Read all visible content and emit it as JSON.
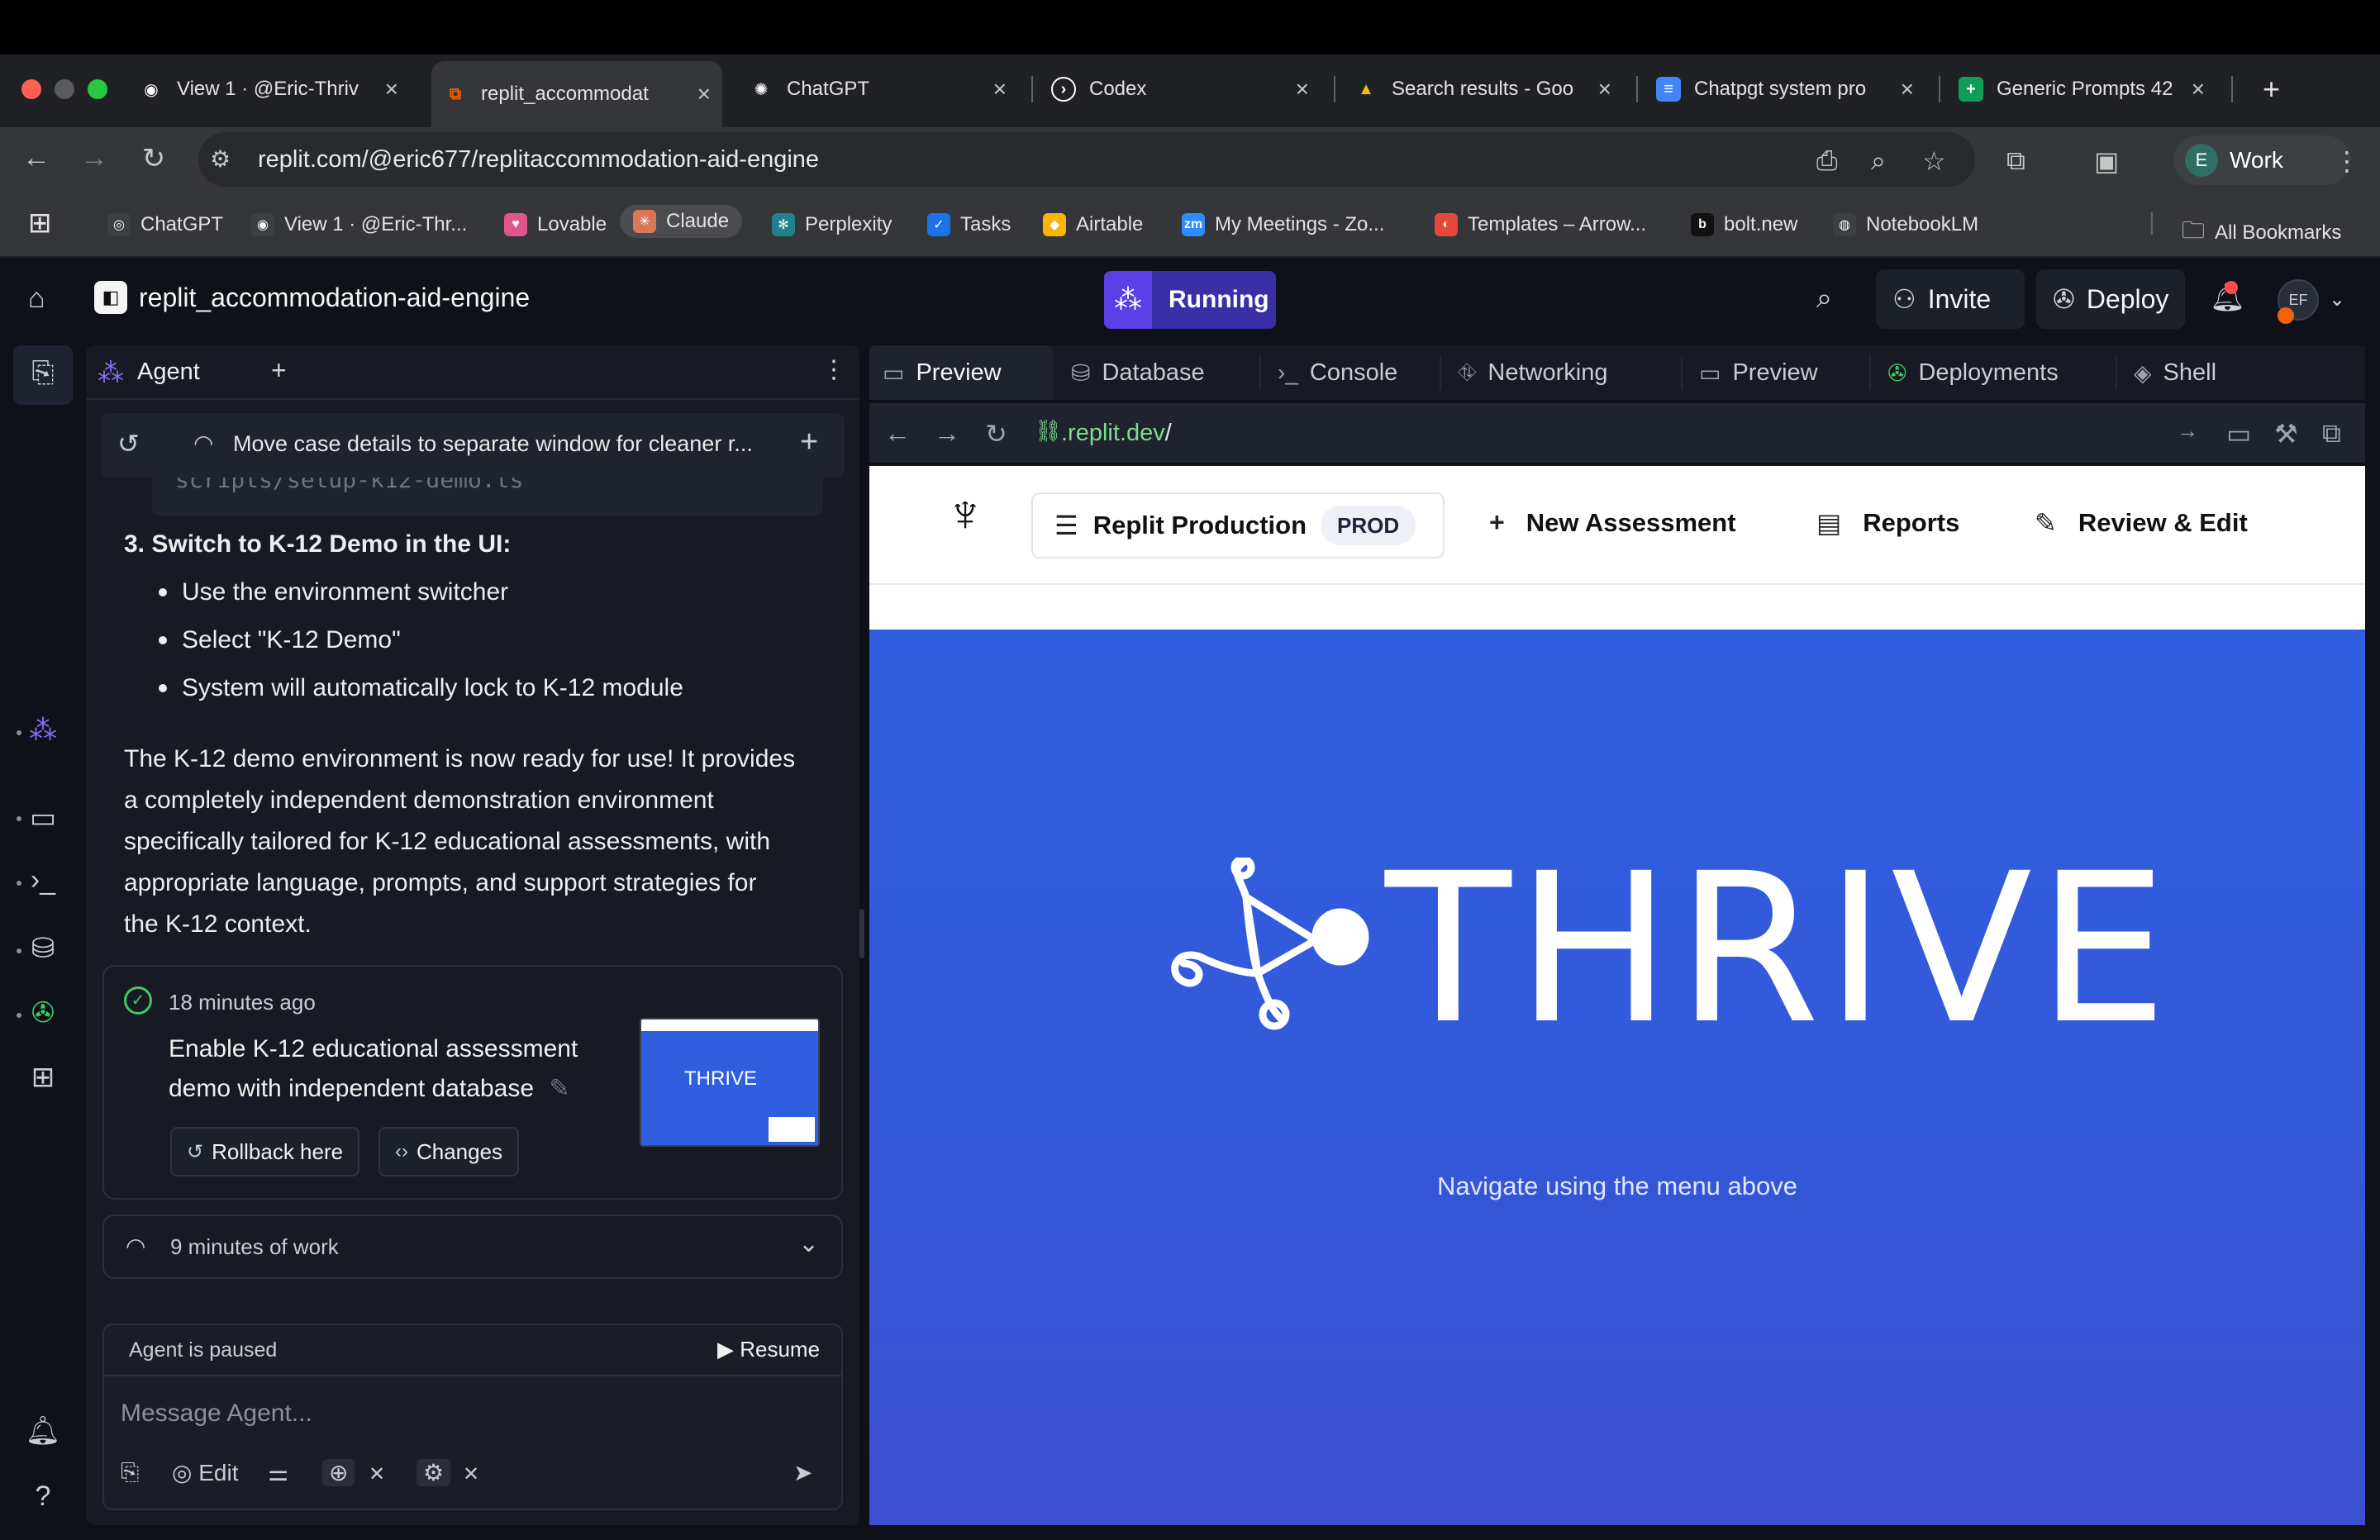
{
  "browser": {
    "tabs": [
      {
        "title": "View 1 · @Eric-Thriv",
        "icon": "github-icon"
      },
      {
        "title": "replit_accommodat",
        "icon": "replit-icon"
      },
      {
        "title": "ChatGPT",
        "icon": "openai-icon"
      },
      {
        "title": "Codex",
        "icon": "codex-icon"
      },
      {
        "title": "Search results - Goo",
        "icon": "google-drive-icon"
      },
      {
        "title": "Chatpgt system pro",
        "icon": "google-docs-icon"
      },
      {
        "title": "Generic Prompts 42",
        "icon": "google-sheets-icon"
      }
    ],
    "new_tab": "+",
    "url": "replit.com/@eric677/replitaccommodation-aid-engine",
    "profile": {
      "initial": "E",
      "name": "Work"
    },
    "bookmarks": [
      {
        "label": "ChatGPT",
        "color": "#3c4043",
        "glyph": "◎"
      },
      {
        "label": "View 1 · @Eric-Thr...",
        "color": "#3c4043",
        "glyph": "◉"
      },
      {
        "label": "Lovable",
        "color": "#e0568c",
        "glyph": "♥"
      },
      {
        "label": "Claude",
        "color": "#d97757",
        "glyph": "✳"
      },
      {
        "label": "Perplexity",
        "color": "#20808d",
        "glyph": "✻"
      },
      {
        "label": "Tasks",
        "color": "#1a73e8",
        "glyph": "✓"
      },
      {
        "label": "Airtable",
        "color": "#fcb400",
        "glyph": "◆"
      },
      {
        "label": "My Meetings - Zo...",
        "color": "#2d8cff",
        "glyph": "zm"
      },
      {
        "label": "Templates – Arrow...",
        "color": "#e5473a",
        "glyph": "◐"
      },
      {
        "label": "bolt.new",
        "color": "#111111",
        "glyph": "b"
      },
      {
        "label": "NotebookLM",
        "color": "#3c4043",
        "glyph": "◍"
      }
    ],
    "all_bookmarks": "All Bookmarks"
  },
  "replit": {
    "project_name": "replit_accommodation-aid-engine",
    "status": "Running",
    "invite": "Invite",
    "deploy": "Deploy",
    "user_initials": "EF"
  },
  "agent": {
    "tab_label": "Agent",
    "history_title": "Move case details to separate window for cleaner r...",
    "code_fragment": "scripts/setup-k12-demo.ts",
    "step3_title": "3. Switch to K-12 Demo in the UI:",
    "bullets": [
      "Use the environment switcher",
      "Select \"K-12 Demo\"",
      "System will automatically lock to K-12 module"
    ],
    "paragraph_lines": [
      "The K-12 demo environment is now ready for use! It provides",
      "a completely independent demonstration environment",
      "specifically tailored for K-12 educational assessments, with",
      "appropriate language, prompts, and support strategies for",
      "the K-12 context."
    ],
    "checkpoint": {
      "time": "18 minutes ago",
      "title_lines": [
        "Enable K-12 educational assessment",
        "demo with independent database"
      ],
      "rollback": "Rollback here",
      "changes": "Changes",
      "thumb_logo": "THRIVE"
    },
    "worklog": "9 minutes of work",
    "paused": "Agent is paused",
    "resume": "Resume",
    "placeholder": "Message Agent...",
    "edit": "Edit"
  },
  "workspace": {
    "tabs": [
      "Preview",
      "Database",
      "Console",
      "Networking",
      "Preview",
      "Deployments",
      "Shell"
    ],
    "url_host": ".replit.dev",
    "url_path": "/"
  },
  "app_preview": {
    "env_name": "Replit Production",
    "env_badge": "PROD",
    "nav_links": [
      "New Assessment",
      "Reports",
      "Review & Edit"
    ],
    "hero_title": "THRIVE",
    "hero_subtitle": "Navigate using the menu above",
    "hero_color": "#3157dc"
  }
}
